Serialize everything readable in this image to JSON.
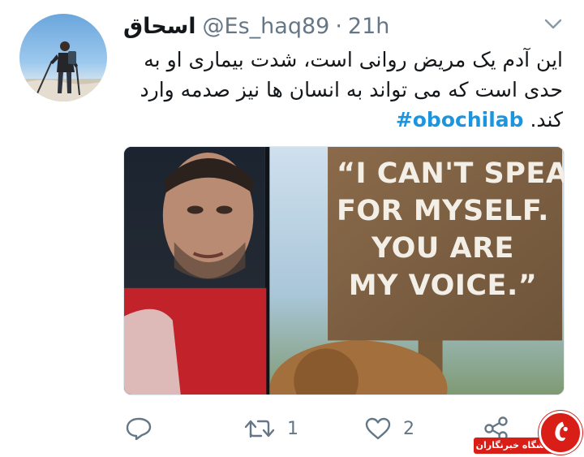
{
  "tweet": {
    "display_name": "اسحاق",
    "handle": "@Es_haq89",
    "separator": "·",
    "timestamp": "21h",
    "text_lines": [
      "این آدم یک مریض روانی است، شدت بیماری او به",
      "حدی است که می تواند به انسان ها نیز صدمه وارد",
      "کند."
    ],
    "hashtag": "#obochilab"
  },
  "media": {
    "sign_lines": [
      "“I CAN'T SPEAK",
      "FOR MYSELF.",
      "YOU ARE",
      "MY VOICE.”"
    ]
  },
  "actions": {
    "reply_icon": "speech-bubble-icon",
    "retweet_icon": "retweet-icon",
    "retweet_count": "1",
    "like_icon": "heart-icon",
    "like_count": "2",
    "share_icon": "share-icon"
  },
  "watermark": {
    "text": "باشگاه خبرنگاران"
  },
  "colors": {
    "link": "#1b95e0",
    "secondary_text": "#657786",
    "watermark_red": "#d91e18"
  }
}
